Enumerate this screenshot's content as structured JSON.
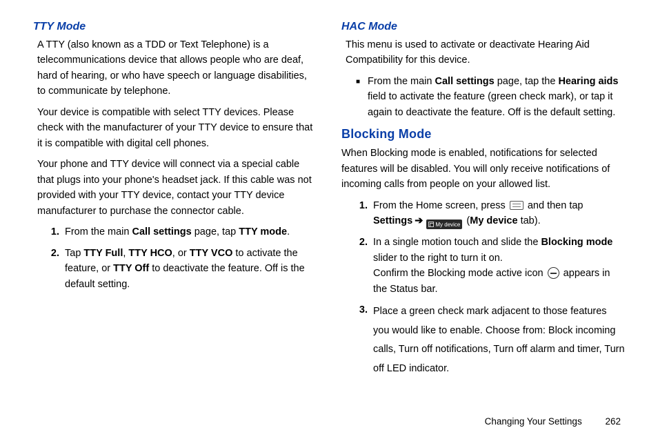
{
  "left": {
    "tty": {
      "heading": "TTY Mode",
      "p1": "A TTY (also known as a TDD or Text Telephone) is a telecommunications device that allows people who are deaf, hard of hearing, or who have speech or language disabilities, to communicate by telephone.",
      "p2": "Your device is compatible with select TTY devices. Please check with the manufacturer of your TTY device to ensure that it is compatible with digital cell phones.",
      "p3": "Your phone and TTY device will connect via a special cable that plugs into your phone's headset jack. If this cable was not provided with your TTY device, contact your TTY device manufacturer to purchase the connector cable.",
      "steps": {
        "n1": "1.",
        "t1a": "From the main ",
        "t1b": "Call settings",
        "t1c": " page, tap ",
        "t1d": "TTY mode",
        "t1e": ".",
        "n2": "2.",
        "t2a": "Tap ",
        "t2b": "TTY Full",
        "t2c": ", ",
        "t2d": "TTY HCO",
        "t2e": ", or ",
        "t2f": "TTY VCO",
        "t2g": " to activate the feature, or ",
        "t2h": "TTY Off",
        "t2i": " to deactivate the feature. Off is the default setting."
      }
    }
  },
  "right": {
    "hac": {
      "heading": "HAC Mode",
      "p1": "This menu is used to activate or deactivate Hearing Aid Compatibility for this device.",
      "b1a": "From the main ",
      "b1b": "Call settings",
      "b1c": " page, tap the ",
      "b1d": "Hearing aids",
      "b1e": " field to activate the feature (green check mark), or tap it again to deactivate the feature. Off is the default setting."
    },
    "blocking": {
      "heading": "Blocking Mode",
      "p1": "When Blocking mode is enabled, notifications for selected features will be disabled. You will only receive notifications of incoming calls from people on your allowed list.",
      "steps": {
        "n1": "1.",
        "t1a": "From the Home screen, press ",
        "t1b": " and then tap ",
        "t1c": "Settings",
        "arrow": "➔",
        "mydev": "My device",
        "t1d": " (",
        "t1e": "My device",
        "t1f": " tab).",
        "n2": "2.",
        "t2a": "In a single motion touch and slide the ",
        "t2b": "Blocking mode",
        "t2c": " slider to the right to turn it on.",
        "t2d": "Confirm the Blocking mode active icon ",
        "t2e": " appears in the Status bar.",
        "n3": "3.",
        "t3": "Place a green check mark adjacent to those features you would like to enable. Choose from: Block incoming calls, Turn off notifications, Turn off alarm and timer, Turn off LED indicator."
      }
    }
  },
  "footer": {
    "section": "Changing Your Settings",
    "page": "262"
  }
}
